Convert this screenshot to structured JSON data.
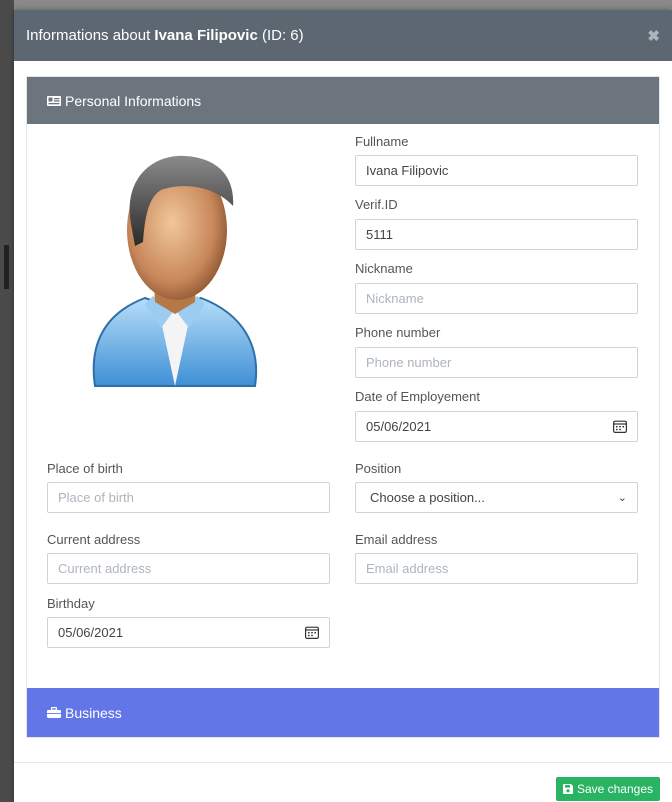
{
  "modal": {
    "title_prefix": "Informations about ",
    "title_name": "Ivana Filipovic",
    "title_suffix": " (ID: 6)",
    "close_label": "✖"
  },
  "personal": {
    "header": "Personal Informations",
    "fields": {
      "fullname": {
        "label": "Fullname",
        "value": "Ivana Filipovic"
      },
      "verif_id": {
        "label": "Verif.ID",
        "value": "5111"
      },
      "nickname": {
        "label": "Nickname",
        "placeholder": "Nickname"
      },
      "phone": {
        "label": "Phone number",
        "placeholder": "Phone number"
      },
      "employment_date": {
        "label": "Date of Employement",
        "value": "05/06/2021"
      },
      "place_of_birth": {
        "label": "Place of birth",
        "placeholder": "Place of birth"
      },
      "position": {
        "label": "Position",
        "selected": "Choose a position..."
      },
      "current_address": {
        "label": "Current address",
        "placeholder": "Current address"
      },
      "email": {
        "label": "Email address",
        "placeholder": "Email address"
      },
      "birthday": {
        "label": "Birthday",
        "value": "05/06/2021"
      }
    }
  },
  "business": {
    "header": "Business"
  },
  "footer": {
    "save_label": "Save changes"
  },
  "colors": {
    "header_bg": "#5d6771",
    "card_header_bg": "#6c757d",
    "business_bg": "#6276e8",
    "save_bg": "#28b463"
  },
  "icons": {
    "card_header": "id-card-icon",
    "date_fields": "calendar-icon",
    "business": "briefcase-icon",
    "save": "floppy-disk-icon",
    "close": "close-icon",
    "select": "chevron-down-icon"
  }
}
